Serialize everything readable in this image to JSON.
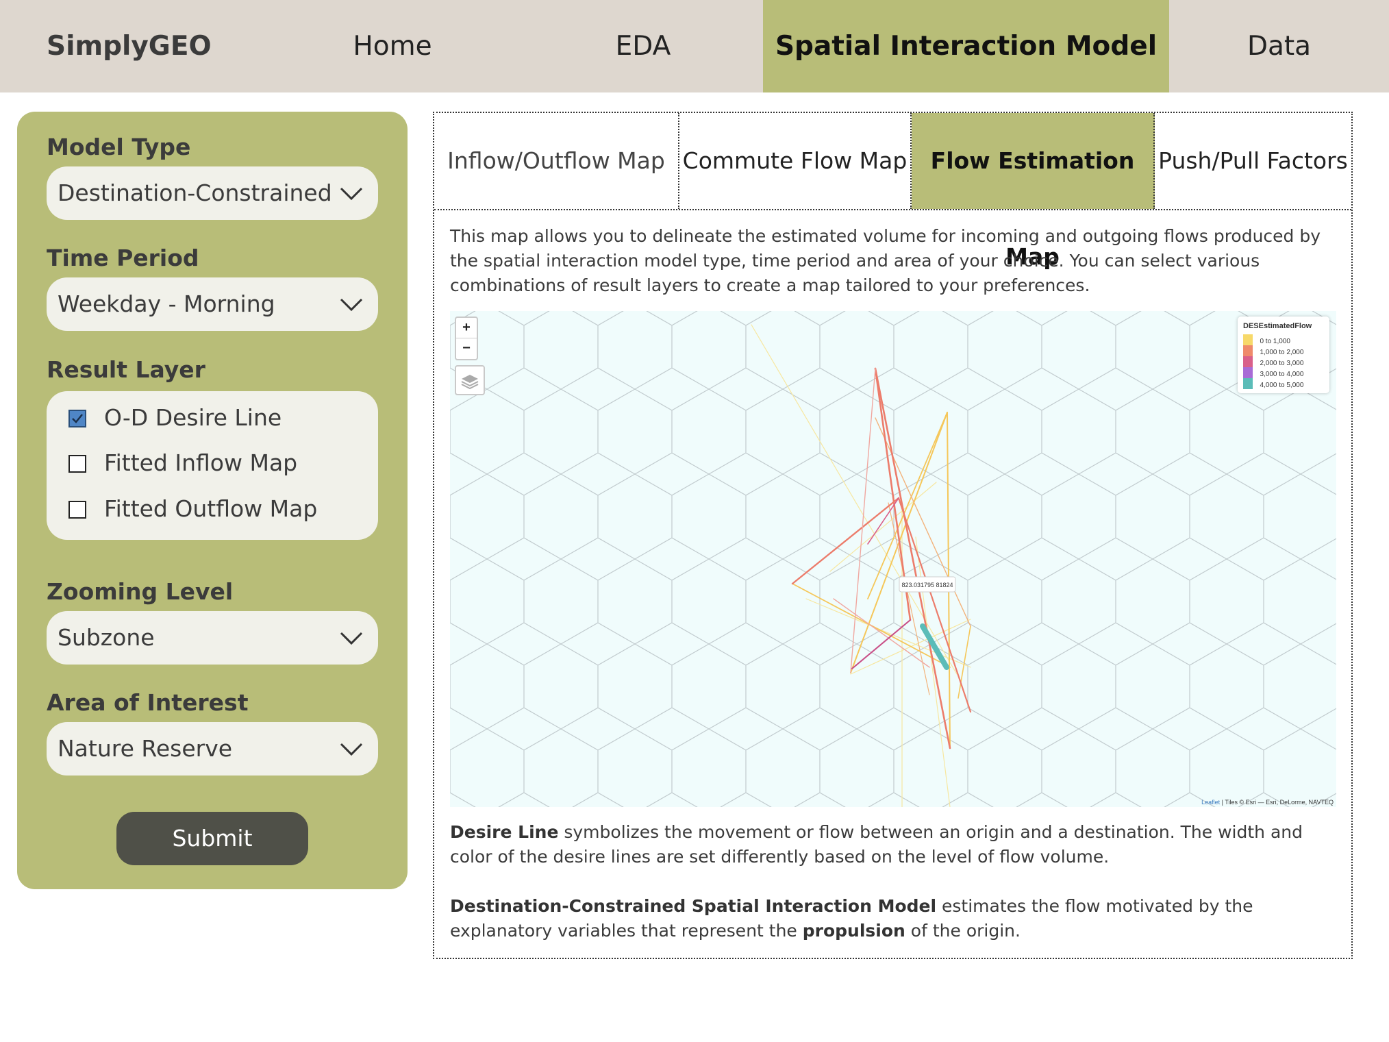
{
  "nav": {
    "brand": "SimplyGEO",
    "items": [
      "Home",
      "EDA",
      "Spatial Interaction Model",
      "Data"
    ],
    "active": "Spatial Interaction Model"
  },
  "sidebar": {
    "model_type": {
      "label": "Model Type",
      "value": "Destination-Constrained"
    },
    "time_period": {
      "label": "Time Period",
      "value": "Weekday - Morning"
    },
    "result_layer": {
      "label": "Result Layer",
      "options": [
        {
          "label": "O-D Desire Line",
          "checked": true
        },
        {
          "label": "Fitted Inflow Map",
          "checked": false
        },
        {
          "label": "Fitted Outflow Map",
          "checked": false
        }
      ]
    },
    "zoom_level": {
      "label": "Zooming Level",
      "value": "Subzone"
    },
    "area": {
      "label": "Area of Interest",
      "value": "Nature Reserve"
    },
    "submit_label": "Submit"
  },
  "tabs": [
    "Inflow/Outflow Map",
    "Commute Flow Map",
    "Flow Estimation Map",
    "Push/Pull Factors"
  ],
  "active_tab": "Flow Estimation Map",
  "description": "This map allows you to delineate the estimated volume for incoming and outgoing flows produced by the spatial interaction model type, time period and area of your choice. You can select various combinations of result layers to create a map tailored to your preferences.",
  "map": {
    "zoom_in": "+",
    "zoom_out": "−",
    "layers_icon": "layers-icon",
    "legend_title": "DESEstimatedFlow",
    "legend": [
      {
        "label": "0 to 1,000",
        "color": "#f7d96a"
      },
      {
        "label": "1,000 to 2,000",
        "color": "#ef8a6b"
      },
      {
        "label": "2,000 to 3,000",
        "color": "#d9608a"
      },
      {
        "label": "3,000 to 4,000",
        "color": "#a86cd6"
      },
      {
        "label": "4,000 to 5,000",
        "color": "#5bbcb8"
      }
    ],
    "popup": "823.031795 81824",
    "attribution_leaflet": "Leaflet",
    "attribution_rest": " | Tiles © Esri — Esri, DeLorme, NAVTEQ"
  },
  "footer": {
    "p1_bold": "Desire Line",
    "p1_rest": " symbolizes the movement or flow between an origin and a destination. The width and color of the desire lines are set differently based on the level of flow volume.",
    "p2_bold": "Destination-Constrained Spatial Interaction Model",
    "p2_mid": " estimates the flow motivated by the explanatory variables that represent the ",
    "p2_bold2": "propulsion",
    "p2_end": " of the origin."
  },
  "colors": {
    "nav_bg": "#ded7cf",
    "accent": "#b8bd78",
    "input_bg": "#f1f1ea",
    "submit_bg": "#4f5048",
    "map_bg": "#f0fcfc"
  }
}
